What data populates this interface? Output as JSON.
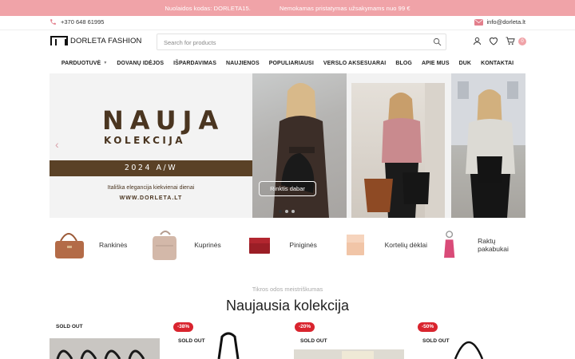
{
  "topbar": {
    "promo": "Nuolaidos kodas: DORLETA15.",
    "shipping": "Nemokamas pristatymas užsakymams nuo 99 €"
  },
  "contact": {
    "phone": "+370 648 61995",
    "email": "info@dorleta.lt"
  },
  "header": {
    "logo_text": "DORLETA FASHION",
    "search_placeholder": "Search for products",
    "cart_count": "0"
  },
  "nav": {
    "items": [
      {
        "label": "PARDUOTUVĖ",
        "has_dropdown": true
      },
      {
        "label": "DOVANŲ IDĖJOS",
        "has_dropdown": false
      },
      {
        "label": "IŠPARDAVIMAS",
        "has_dropdown": false
      },
      {
        "label": "NAUJIENOS",
        "has_dropdown": false
      },
      {
        "label": "POPULIARIAUSI",
        "has_dropdown": false
      },
      {
        "label": "VERSLO AKSESUARAI",
        "has_dropdown": false
      },
      {
        "label": "BLOG",
        "has_dropdown": false
      },
      {
        "label": "APIE MUS",
        "has_dropdown": false
      },
      {
        "label": "DUK",
        "has_dropdown": false
      },
      {
        "label": "KONTAKTAI",
        "has_dropdown": false
      }
    ]
  },
  "hero": {
    "title": "NAUJA",
    "subtitle": "KOLEKCIJA",
    "season": "2024 A/W",
    "tagline": "Itališka elegancija kiekvienai dienai",
    "website": "WWW.DORLETA.LT",
    "cta": "Rinktis dabar",
    "slide_count": 3,
    "active_slide": 1
  },
  "categories": [
    {
      "label": "Rankinės"
    },
    {
      "label": "Kuprinės"
    },
    {
      "label": "Piniginės"
    },
    {
      "label": "Kortelių dėklai"
    },
    {
      "label": "Raktų pakabukai"
    }
  ],
  "section": {
    "subheading": "Tikros odos meistriškumas",
    "heading": "Naujausia kolekcija"
  },
  "products": [
    {
      "sale": "",
      "status": "SOLD OUT"
    },
    {
      "sale": "-38%",
      "status": "SOLD OUT"
    },
    {
      "sale": "-20%",
      "status": "SOLD OUT"
    },
    {
      "sale": "-50%",
      "status": "SOLD OUT"
    }
  ],
  "colors": {
    "accent": "#f0a3a8",
    "brand_brown": "#5a4126",
    "sale_red": "#d9242e"
  }
}
